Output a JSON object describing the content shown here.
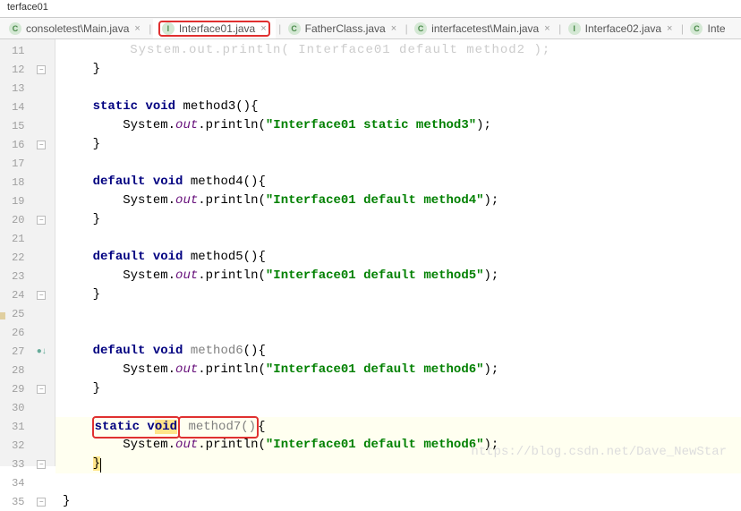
{
  "title": "terface01",
  "tabs": [
    {
      "icon": "C",
      "label": "consoletest\\Main.java"
    },
    {
      "icon": "I",
      "label": "Interface01.java",
      "active": true,
      "highlighted": true
    },
    {
      "icon": "C",
      "label": "FatherClass.java"
    },
    {
      "icon": "C",
      "label": "interfacetest\\Main.java"
    },
    {
      "icon": "I",
      "label": "Interface02.java"
    },
    {
      "icon": "C",
      "label": "Inte"
    }
  ],
  "lines": {
    "start": 11,
    "end": 35
  },
  "code": {
    "l11_partial": "System.out.println(\"Interface01 default method2\");",
    "l12": "    }",
    "l14_sig": "static void method3(){",
    "l15_call": "System.out.println(",
    "l15_str": "\"Interface01 static method3\"",
    "l15_end": ");",
    "l16": "    }",
    "l18_sig": "default void method4(){",
    "l19_str": "\"Interface01 default method4\"",
    "l20": "    }",
    "l22_sig": "default void method5(){",
    "l23_str": "\"Interface01 default method5\"",
    "l24": "    }",
    "l27_sig_a": "default void ",
    "l27_sig_b": "method6",
    "l27_sig_c": "(){",
    "l28_str": "\"Interface01 default method6\"",
    "l29": "    }",
    "l31_a": "static v",
    "l31_b": "oid",
    "l31_c": " method7()",
    "l31_d": "{",
    "l32_str": "\"Interface01 default method6\"",
    "l33": "}",
    "l35": "}",
    "kw_static": "static",
    "kw_void": "void",
    "kw_default": "default",
    "sys": "System",
    "out": "out",
    "println": "println"
  },
  "watermark": "https://blog.csdn.net/Dave_NewStar"
}
